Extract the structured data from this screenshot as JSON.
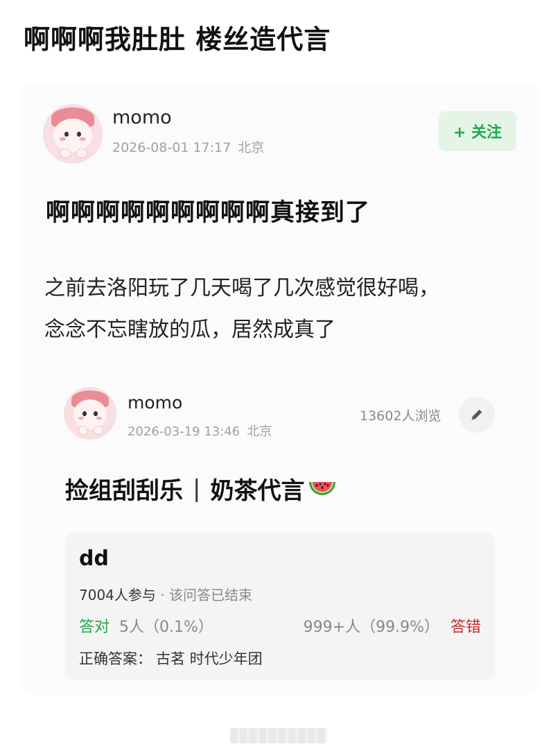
{
  "page": {
    "title": "啊啊啊我肚肚 楼丝造代言"
  },
  "post": {
    "author": "momo",
    "time": "2026-08-01 17:17",
    "location": "北京",
    "follow_label": "+ 关注",
    "headline": "啊啊啊啊啊啊啊啊啊真接到了",
    "body_lines": [
      "之前去洛阳玩了几天喝了几次感觉很好喝，",
      "念念不忘瞎放的瓜，居然成真了"
    ]
  },
  "shared_post": {
    "author": "momo",
    "time": "2026-03-19 13:46",
    "location": "北京",
    "views": "13602人浏览",
    "title_left": "捡组刮刮乐",
    "title_sep": "|",
    "title_right": "奶茶代言",
    "title_icon": "watermelon-icon"
  },
  "quiz": {
    "question": "dd",
    "participants": "7004人参与",
    "status": "· 该问答已结束",
    "correct_label": "答对",
    "correct_count": "5人（0.1%）",
    "wrong_count": "999+人（99.9%）",
    "wrong_label": "答错",
    "answer_label": "正确答案：",
    "answer_value": "古茗 时代少年团"
  },
  "colors": {
    "follow_green": "#21a84a",
    "correct_green": "#27a24b",
    "wrong_red": "#c62d2d"
  }
}
